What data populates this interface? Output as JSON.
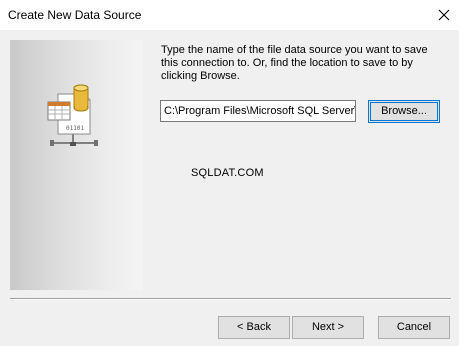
{
  "window": {
    "title": "Create New Data Source",
    "close_label": "✕"
  },
  "wizard": {
    "instructions": "Type the name of the file data source you want to save this connection to.  Or, find the location to save to by clicking Browse.",
    "path_value": "C:\\Program Files\\Microsoft SQL Server\\",
    "browse_label": "Browse...",
    "watermark": "SQLDAT.COM"
  },
  "buttons": {
    "back": "< Back",
    "next": "Next >",
    "cancel": "Cancel"
  },
  "icons": {
    "wizard_icon": "data-source-wizard-icon",
    "close_icon": "close-icon"
  },
  "colors": {
    "focus_border": "#0078d7",
    "database_cylinder": "#e8b93a"
  }
}
